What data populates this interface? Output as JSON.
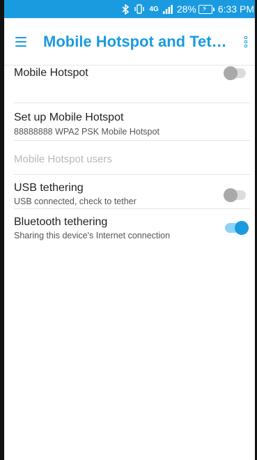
{
  "status_bar": {
    "bluetooth_icon": "bluetooth-icon",
    "vibrate_icon": "vibrate-icon",
    "network": "4G",
    "battery": "28%",
    "time": "6:33 PM"
  },
  "app_bar": {
    "title": "Mobile Hotspot and Teth..."
  },
  "settings": {
    "mobile_hotspot": {
      "title": "Mobile Hotspot",
      "enabled": false
    },
    "setup": {
      "title": "Set up Mobile Hotspot",
      "subtitle": "88888888 WPA2 PSK Mobile Hotspot"
    },
    "users": {
      "title": "Mobile Hotspot users"
    },
    "usb": {
      "title": "USB tethering",
      "subtitle": "USB connected, check to tether",
      "enabled": false
    },
    "bluetooth": {
      "title": "Bluetooth tethering",
      "subtitle": "Sharing this device's Internet connection",
      "enabled": true
    }
  },
  "colors": {
    "accent": "#1a9be0"
  }
}
